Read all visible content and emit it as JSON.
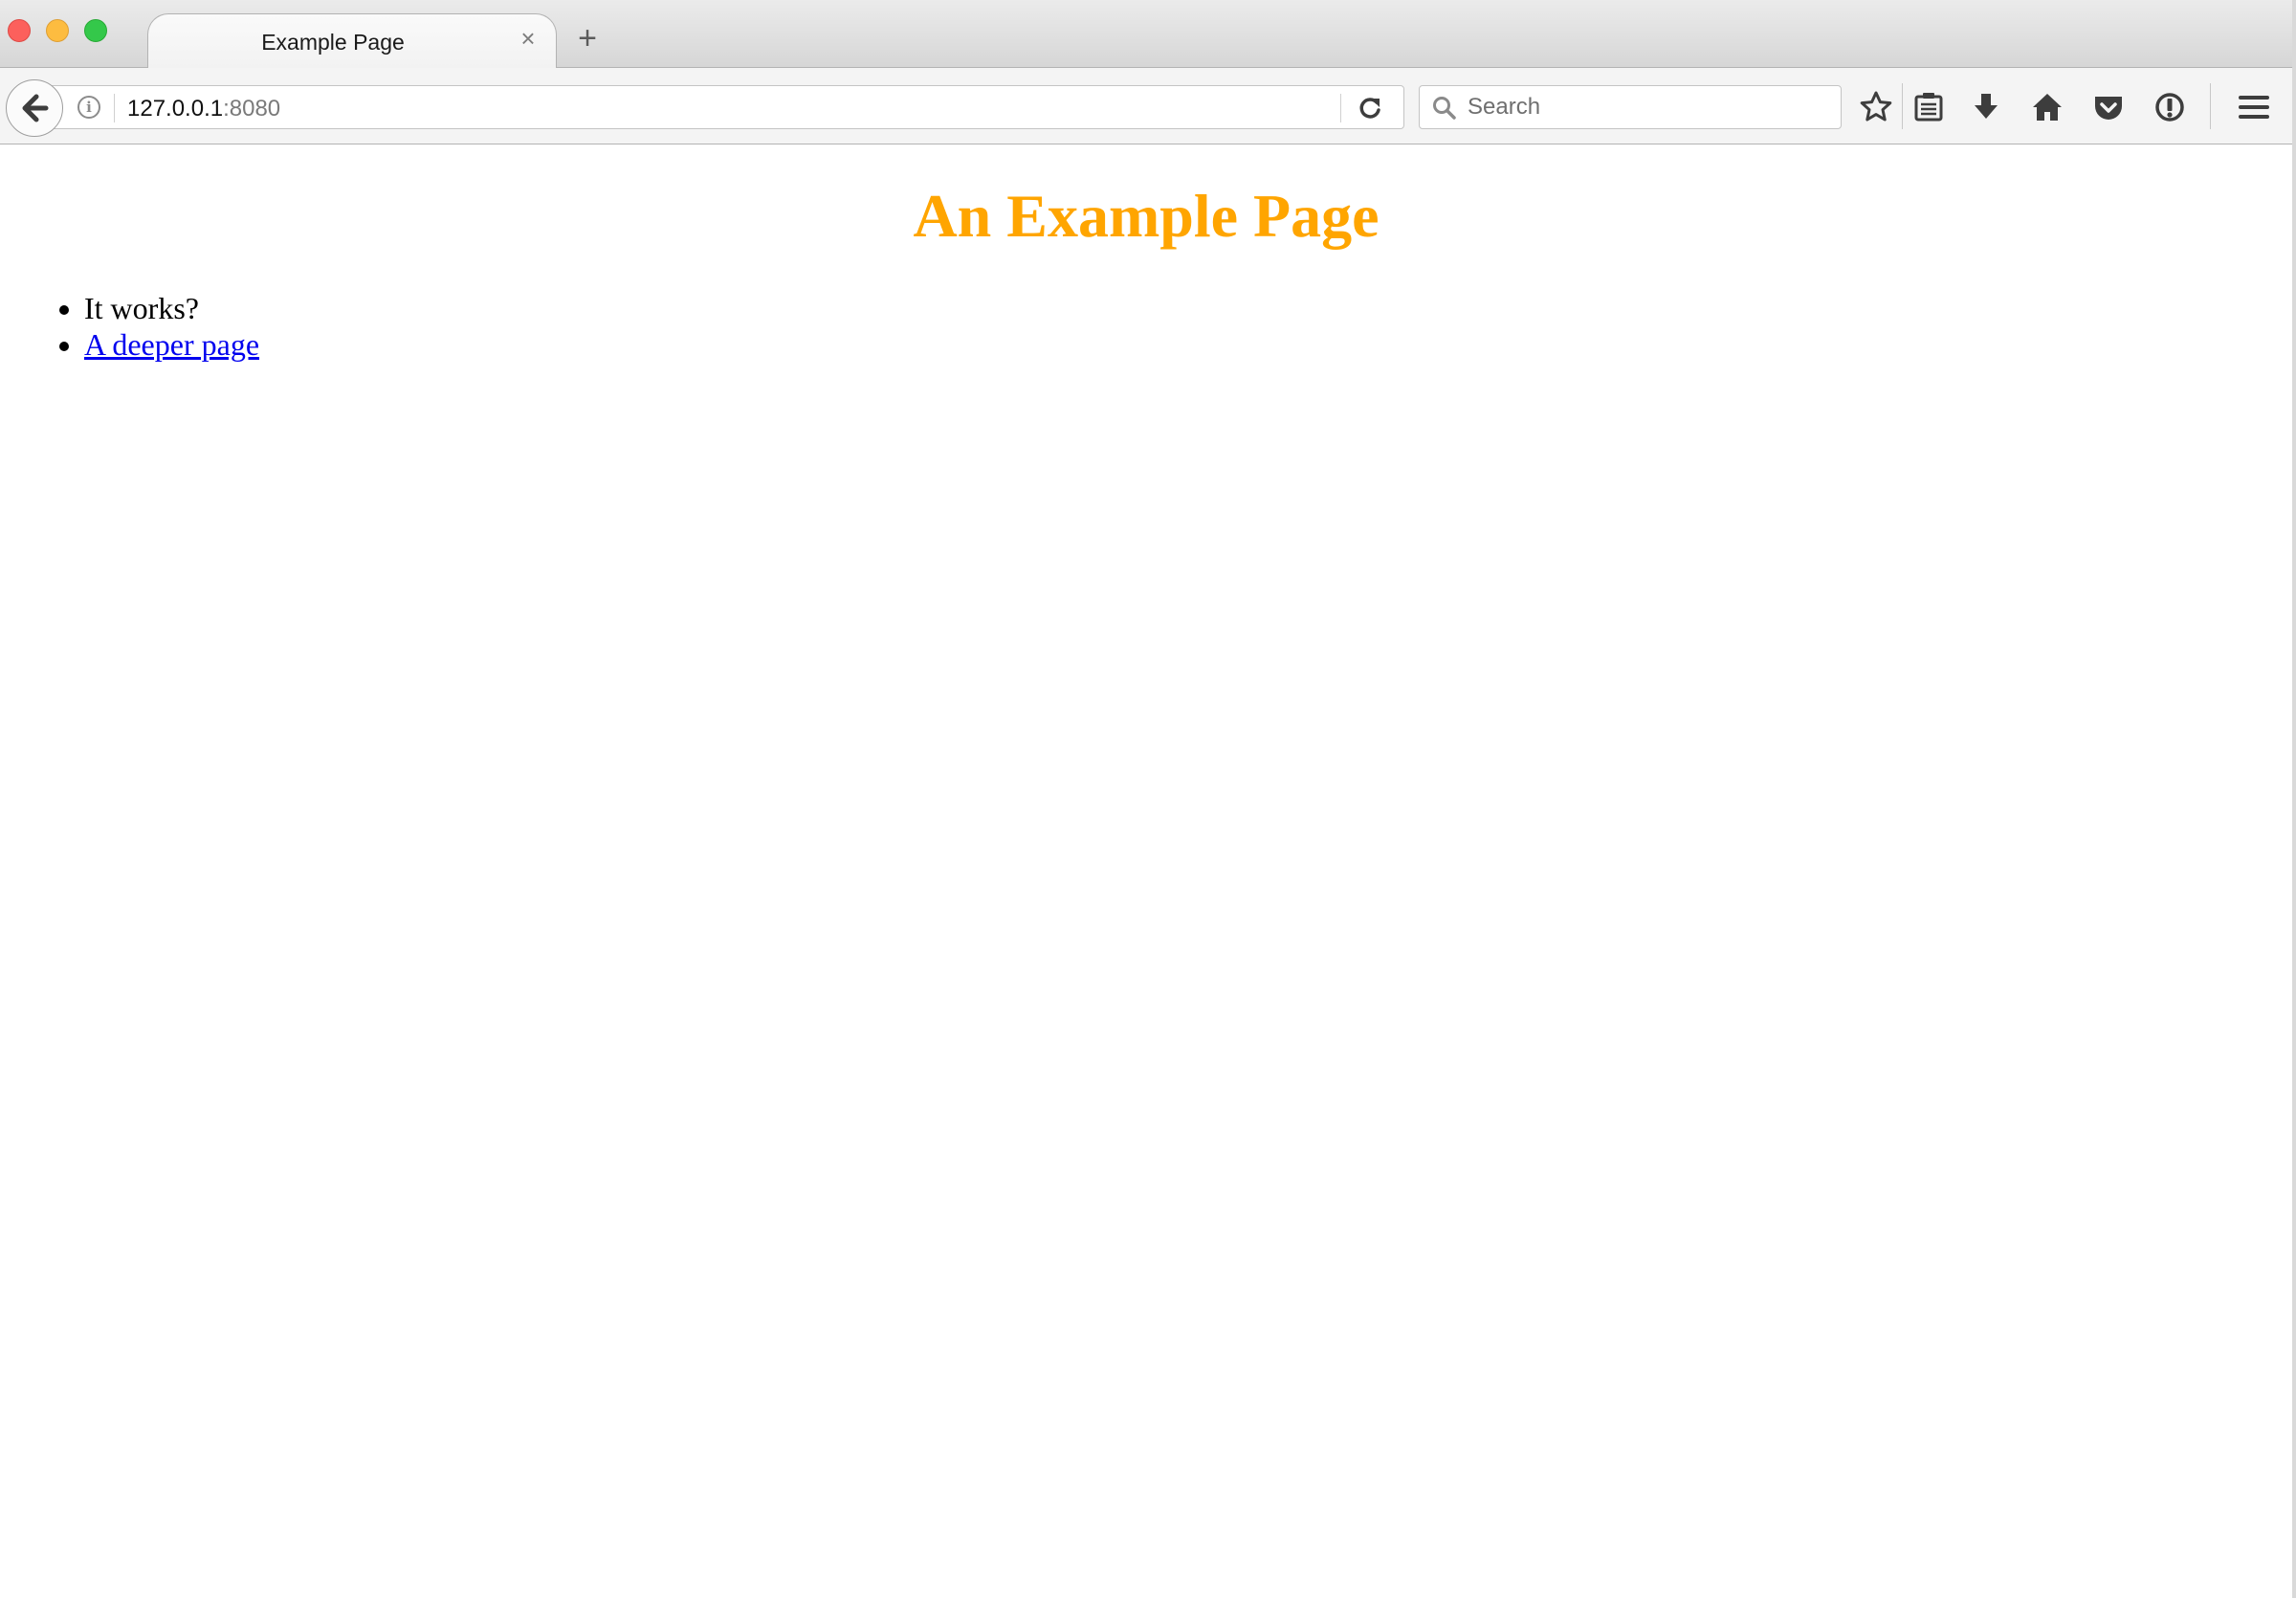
{
  "window": {
    "controls": [
      "close",
      "minimize",
      "maximize"
    ]
  },
  "tabs": [
    {
      "title": "Example Page",
      "close_glyph": "×",
      "active": true
    }
  ],
  "new_tab_glyph": "+",
  "navbar": {
    "back_icon": "back-arrow-icon",
    "site_info_glyph": "i",
    "url_host": "127.0.0.1",
    "url_port": ":8080",
    "reload_icon": "reload-icon",
    "search_placeholder": "Search",
    "search_value": "",
    "toolbar_icons": [
      "bookmark-star-icon",
      "reader-view-icon",
      "downloads-icon",
      "home-icon",
      "pocket-icon",
      "identity-icon",
      "hamburger-menu-icon"
    ]
  },
  "page": {
    "title": "An Example Page",
    "list_item_text": "It works?",
    "list_item_link": "A deeper page"
  },
  "colors": {
    "title_color": "#ffa500",
    "link_color": "#0000ee",
    "close_button": "#fc605c",
    "minimize_button": "#fdbc40",
    "maximize_button": "#34c84a"
  }
}
